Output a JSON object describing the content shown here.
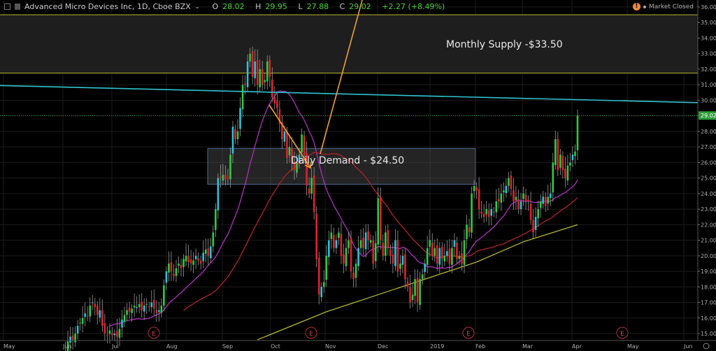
{
  "header": {
    "symbol": "Advanced Micro Devices Inc, 1D, Cboe BZX",
    "open_label": "O",
    "open": "28.02",
    "high_label": "H",
    "high": "29.95",
    "low_label": "L",
    "low": "27.88",
    "close_label": "C",
    "close": "29.02",
    "change": "+2.27 (+8.49%)",
    "market_status": "Market Closed"
  },
  "colors": {
    "up": "#2ecc40",
    "up_alt": "#26c6da",
    "down": "#e0232e",
    "ma20": "#b02fc0",
    "ma50": "#b3202a",
    "ma200": "#b5b530",
    "trend": "#2fc4d0",
    "arrow": "#f0a030",
    "zone_line": "#b8b830",
    "last": "#2e9e3a"
  },
  "annotations": {
    "supply_label": "Monthly Supply -$33.50",
    "demand_label": "Daily Demand - $24.50",
    "earnings_marker": "E"
  },
  "chart_data": {
    "type": "candlestick",
    "title": "Advanced Micro Devices Inc, 1D, Cboe BZX",
    "ylim": [
      14.6,
      36.4
    ],
    "y_ticks": [
      "36.00",
      "35.00",
      "34.00",
      "33.00",
      "32.00",
      "31.00",
      "30.00",
      "29.00",
      "28.00",
      "27.00",
      "26.00",
      "25.00",
      "24.00",
      "23.00",
      "22.00",
      "21.00",
      "20.00",
      "19.00",
      "18.00",
      "17.00",
      "16.00",
      "15.00"
    ],
    "x_ticks": [
      "May",
      "Jun",
      "Jul",
      "Aug",
      "Sep",
      "Oct",
      "Nov",
      "Dec",
      "2019",
      "Feb",
      "Mar",
      "Apr",
      "May",
      "Jun"
    ],
    "last_price": "29.02",
    "closes": [
      13.5,
      13.7,
      14.5,
      14.8,
      14.6,
      15.0,
      15.5,
      15.7,
      16.0,
      16.3,
      16.1,
      16.8,
      17.0,
      16.7,
      16.2,
      16.5,
      15.5,
      15.0,
      14.9,
      15.2,
      14.9,
      15.0,
      14.8,
      15.3,
      15.9,
      16.2,
      16.5,
      16.4,
      16.6,
      16.8,
      16.7,
      16.9,
      16.5,
      16.8,
      16.9,
      16.7,
      17.0,
      16.6,
      16.3,
      16.5,
      16.8,
      18.1,
      19.0,
      19.5,
      19.0,
      18.7,
      19.2,
      19.5,
      19.2,
      19.8,
      20.0,
      19.6,
      19.5,
      19.7,
      20.0,
      19.7,
      19.5,
      20.2,
      20.4,
      20.0,
      20.6,
      21.5,
      23.0,
      25.0,
      25.0,
      25.2,
      24.9,
      25.0,
      26.5,
      28.3,
      27.5,
      28.0,
      29.5,
      31.0,
      31.0,
      32.5,
      33.0,
      31.5,
      32.5,
      31.0,
      32.0,
      31.0,
      31.3,
      32.5,
      31.5,
      30.2,
      29.8,
      29.5,
      28.5,
      27.5,
      28.0,
      26.3,
      27.0,
      26.0,
      25.5,
      26.0,
      26.5,
      27.8,
      26.5,
      24.5,
      24.0,
      25.0,
      22.8,
      19.8,
      17.5,
      18.0,
      18.3,
      20.0,
      21.0,
      21.5,
      20.5,
      21.0,
      21.5,
      20.0,
      19.5,
      20.5,
      21.0,
      19.0,
      18.5,
      19.5,
      20.5,
      21.0,
      20.5,
      21.5,
      21.0,
      21.0,
      19.5,
      20.8,
      23.7,
      21.0,
      20.0,
      21.5,
      20.5,
      20.0,
      19.5,
      21.0,
      19.0,
      19.5,
      20.0,
      18.5,
      18.0,
      17.0,
      17.5,
      18.5,
      17.0,
      18.5,
      18.8,
      19.5,
      20.5,
      21.0,
      20.0,
      20.5,
      19.5,
      20.5,
      19.8,
      20.0,
      20.3,
      19.5,
      20.5,
      21.0,
      19.8,
      20.0,
      19.5,
      21.0,
      22.0,
      21.5,
      24.0,
      24.5,
      24.2,
      23.0,
      22.7,
      22.5,
      23.0,
      22.5,
      23.0,
      22.8,
      23.5,
      23.5,
      24.0,
      24.2,
      24.5,
      25.0,
      24.3,
      23.5,
      23.8,
      23.0,
      23.5,
      24.0,
      23.5,
      23.5,
      22.3,
      21.5,
      22.5,
      23.0,
      23.5,
      23.8,
      23.2,
      23.8,
      24.0,
      26.0,
      27.5,
      25.5,
      26.5,
      25.5,
      25.0,
      25.8,
      26.0,
      26.5,
      26.7,
      29.02
    ],
    "ma200_points": [
      [
        79,
        14.6
      ],
      [
        107,
        16.4
      ],
      [
        128,
        17.5
      ],
      [
        147,
        18.5
      ],
      [
        168,
        19.6
      ],
      [
        187,
        20.9
      ],
      [
        209,
        22.0
      ]
    ],
    "moving_averages": [
      "SMA 20",
      "SMA 50",
      "SMA 200"
    ],
    "supply_zone": [
      31.75,
      35.5
    ],
    "demand_zone": [
      24.6,
      26.9
    ],
    "trendline": [
      30.95,
      29.85
    ]
  }
}
